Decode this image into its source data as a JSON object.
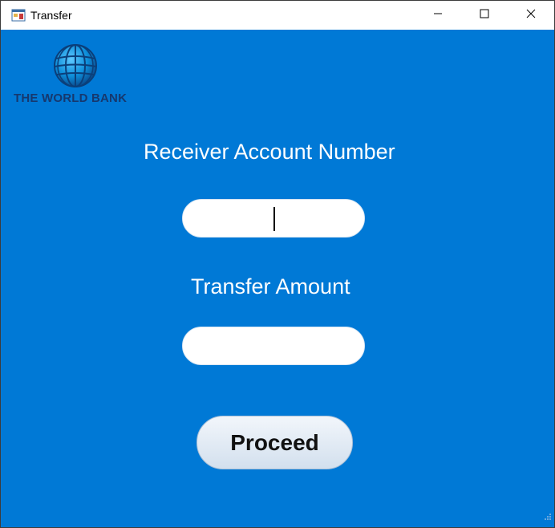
{
  "window": {
    "title": "Transfer",
    "icons": {
      "app": "app-form-icon",
      "minimize": "minimize-icon",
      "maximize": "maximize-icon",
      "close": "close-icon"
    }
  },
  "logo": {
    "text": "THE WORLD BANK",
    "icon": "globe-icon"
  },
  "form": {
    "account_label": "Receiver Account Number",
    "account_value": "",
    "amount_label": "Transfer Amount",
    "amount_value": "",
    "proceed_label": "Proceed"
  },
  "colors": {
    "background": "#0079d6",
    "label_text": "#ffffff",
    "logo_text": "#16386e"
  }
}
